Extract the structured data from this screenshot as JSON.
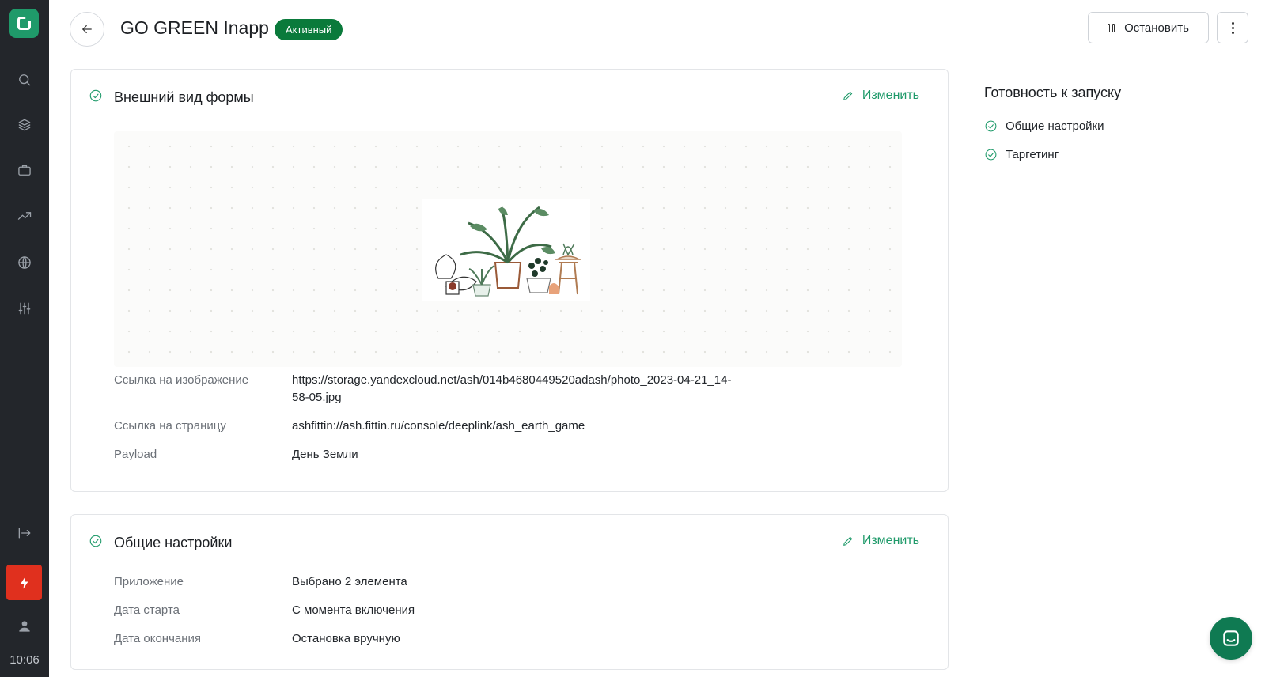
{
  "app": {
    "time": "10:06",
    "logo_icon": "app-logo-icon"
  },
  "sidebar": {
    "items": [
      {
        "name": "search-icon"
      },
      {
        "name": "layers-icon"
      },
      {
        "name": "briefcase-icon"
      },
      {
        "name": "trending-up-icon"
      },
      {
        "name": "globe-icon"
      },
      {
        "name": "sliders-icon"
      },
      {
        "name": "collapse-icon"
      },
      {
        "name": "bolt-icon"
      },
      {
        "name": "user-icon"
      }
    ],
    "accent": "#e0301e"
  },
  "header": {
    "title": "GO GREEN Inapp",
    "status": "Активный",
    "stop_label": "Остановить"
  },
  "appearance_card": {
    "title": "Внешний вид формы",
    "edit_label": "Изменить",
    "fields": [
      {
        "label": "Ссылка на изображение",
        "value": "https://storage.yandexcloud.net/ash/014b4680449520adash/photo_2023-04-21_14-58-05.jpg"
      },
      {
        "label": "Ссылка на страницу",
        "value": "ashfittin://ash.fittin.ru/console/deeplink/ash_earth_game"
      },
      {
        "label": "Payload",
        "value": "День Земли"
      }
    ]
  },
  "general_card": {
    "title": "Общие настройки",
    "edit_label": "Изменить",
    "fields": [
      {
        "label": "Приложение",
        "value": "Выбрано 2 элемента"
      },
      {
        "label": "Дата старта",
        "value": "С момента включения"
      },
      {
        "label": "Дата окончания",
        "value": "Остановка вручную"
      }
    ]
  },
  "readiness": {
    "title": "Готовность к запуску",
    "items": [
      "Общие настройки",
      "Таргетинг"
    ]
  },
  "colors": {
    "brand": "#1f9a6a",
    "status_badge": "#0a7a3b",
    "sidebar_bg": "#23262b"
  }
}
